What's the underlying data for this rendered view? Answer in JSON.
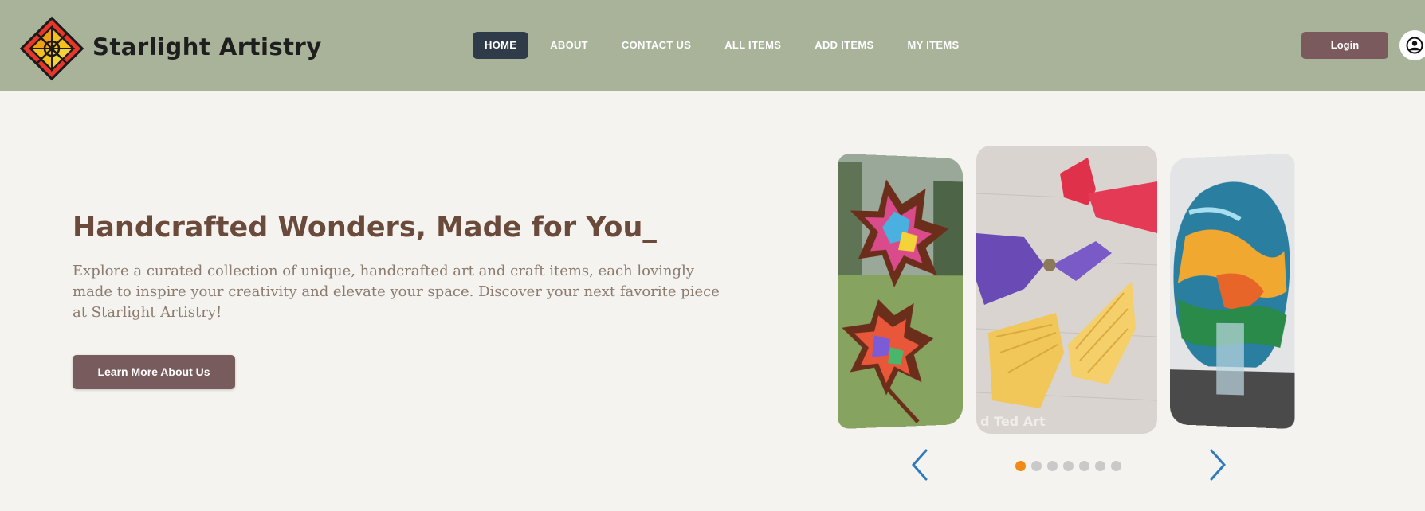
{
  "header": {
    "brand": "Starlight Artistry",
    "nav": [
      {
        "label": "HOME",
        "active": true
      },
      {
        "label": "ABOUT",
        "active": false
      },
      {
        "label": "CONTACT US",
        "active": false
      },
      {
        "label": "ALL ITEMS",
        "active": false
      },
      {
        "label": "ADD ITEMS",
        "active": false
      },
      {
        "label": "MY ITEMS",
        "active": false
      }
    ],
    "login_label": "Login",
    "avatar_icon": "user-circle-icon",
    "colors": {
      "header_bg": "#a8b39a",
      "active_nav": "#2f3b48",
      "login_bg": "#7a5a5d"
    }
  },
  "hero": {
    "title": "Handcrafted Wonders, Made for You_",
    "description": "Explore a curated collection of unique, handcrafted art and craft items, each lovingly made to inspire your creativity and elevate your space. Discover your next favorite piece at Starlight Artistry!",
    "cta_label": "Learn More About Us",
    "colors": {
      "title": "#6a4a3a",
      "cta_bg": "#785b5c"
    }
  },
  "carousel": {
    "slides": [
      {
        "subject": "tissue paper leaf suncatchers"
      },
      {
        "subject": "folded paper butterflies",
        "watermark": "d Ted Art"
      },
      {
        "subject": "blown glass vase"
      }
    ],
    "prev_icon": "chevron-left-icon",
    "next_icon": "chevron-right-icon",
    "dot_count": 7,
    "active_dot": 0,
    "colors": {
      "arrow": "#2c7bbf",
      "active_dot": "#f08a14"
    }
  }
}
